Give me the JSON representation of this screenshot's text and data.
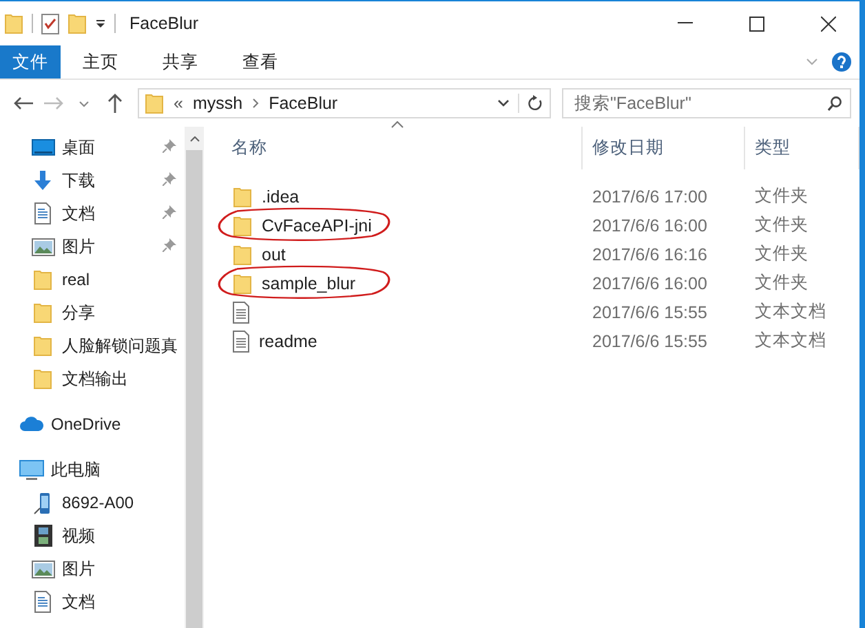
{
  "window": {
    "title": "FaceBlur"
  },
  "ribbon": {
    "tabs": [
      {
        "label": "文件",
        "kind": "file",
        "selected": false
      },
      {
        "label": "主页",
        "kind": "tab",
        "selected": false
      },
      {
        "label": "共享",
        "kind": "tab",
        "selected": false
      },
      {
        "label": "查看",
        "kind": "tab",
        "selected": false
      }
    ]
  },
  "address_bar": {
    "overflow": "«",
    "path": [
      "myssh",
      "FaceBlur"
    ]
  },
  "search": {
    "placeholder": "搜索\"FaceBlur\""
  },
  "sidebar": {
    "items": [
      {
        "label": "桌面",
        "kind": "desktop",
        "pinned": true
      },
      {
        "label": "下载",
        "kind": "download",
        "pinned": true
      },
      {
        "label": "文档",
        "kind": "document",
        "pinned": true
      },
      {
        "label": "图片",
        "kind": "picture",
        "pinned": true
      },
      {
        "label": "real",
        "kind": "folder",
        "pinned": false
      },
      {
        "label": "分享",
        "kind": "folder",
        "pinned": false
      },
      {
        "label": "人脸解锁问题真",
        "kind": "folder",
        "pinned": false
      },
      {
        "label": "文档输出",
        "kind": "folder",
        "pinned": false
      },
      {
        "label": "OneDrive",
        "kind": "cloud",
        "pinned": false
      },
      {
        "label": "此电脑",
        "kind": "pc",
        "pinned": false,
        "children": [
          {
            "label": "8692-A00",
            "kind": "device",
            "pinned": false
          },
          {
            "label": "视频",
            "kind": "video",
            "pinned": false
          },
          {
            "label": "图片",
            "kind": "picture",
            "pinned": false
          },
          {
            "label": "文档",
            "kind": "document",
            "pinned": false
          }
        ]
      }
    ]
  },
  "table": {
    "columns": [
      {
        "label": "名称",
        "sorted": true
      },
      {
        "label": "修改日期",
        "sorted": false
      },
      {
        "label": "类型",
        "sorted": false
      }
    ],
    "rows": [
      {
        "name": ".idea",
        "date": "2017/6/6 17:00",
        "type": "文件夹",
        "kind": "folder",
        "annotated": false
      },
      {
        "name": "CvFaceAPI-jni",
        "date": "2017/6/6 16:00",
        "type": "文件夹",
        "kind": "folder",
        "annotated": true
      },
      {
        "name": "out",
        "date": "2017/6/6 16:16",
        "type": "文件夹",
        "kind": "folder",
        "annotated": false
      },
      {
        "name": "sample_blur",
        "date": "2017/6/6 16:00",
        "type": "文件夹",
        "kind": "folder",
        "annotated": true
      },
      {
        "date": "2017/6/6 15:55",
        "type": "文本文档",
        "kind": "text",
        "annotated": false
      },
      {
        "name": "readme",
        "date": "2017/6/6 15:55",
        "type": "文本文档",
        "kind": "text",
        "annotated": false
      }
    ]
  }
}
